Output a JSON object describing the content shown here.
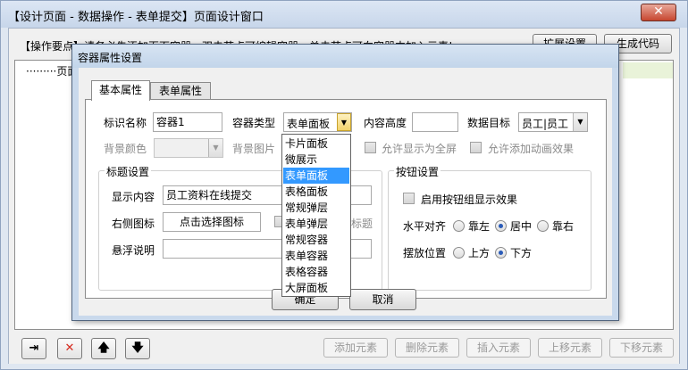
{
  "main_window": {
    "title": "【设计页面 - 数据操作 - 表单提交】页面设计窗口",
    "close_glyph": "✕",
    "hint": "【操作要点】请务必先添加页面容器，双击节点可编辑容器，单击节点可向容器中加入元素!",
    "buttons": {
      "extend": "扩展设置",
      "generate": "生成代码"
    },
    "tree": {
      "root_label": "·········页面容器"
    },
    "bottom_icons": {
      "insert_glyph": "⇥",
      "delete_glyph": "✕",
      "up_glyph": "🡅",
      "down_glyph": "🡇"
    },
    "bottom_buttons": {
      "add": "添加元素",
      "delete": "删除元素",
      "insert": "插入元素",
      "move_up": "上移元素",
      "move_down": "下移元素"
    },
    "colors": {
      "delete_icon": "#d62b1f"
    }
  },
  "dialog": {
    "title": "容器属性设置",
    "tabs": [
      "基本属性",
      "表单属性"
    ],
    "fields": {
      "id_label": "标识名称",
      "id_value": "容器1",
      "type_label": "容器类型",
      "type_value": "表单面板",
      "height_label": "内容高度",
      "height_value": "",
      "target_label": "数据目标",
      "target_value": "员工|员工",
      "bg_color_label": "背景颜色",
      "bg_image_label": "背景图片",
      "allow_fullscreen": "允许显示为全屏",
      "allow_animation": "允许添加动画效果"
    },
    "title_group": {
      "title": "标题设置",
      "display_label": "显示内容",
      "display_value": "员工资料在线提交",
      "right_icon_label": "右侧图标",
      "right_icon_button": "点击选择图标",
      "show_title_suffix": "标题",
      "tooltip_label": "悬浮说明",
      "tooltip_value": ""
    },
    "button_group": {
      "title": "按钮设置",
      "enable_effect": "启用按钮组显示效果",
      "h_align_label": "水平对齐",
      "h_align_options": [
        "靠左",
        "居中",
        "靠右"
      ],
      "h_align_selected": "居中",
      "position_label": "摆放位置",
      "position_options": [
        "上方",
        "下方"
      ],
      "position_selected": "下方"
    },
    "ok_button": "确定",
    "cancel_button": "取消",
    "type_dropdown": {
      "options": [
        "卡片面板",
        "微展示",
        "表单面板",
        "表格面板",
        "常规弹层",
        "表单弹层",
        "常规容器",
        "表单容器",
        "表格容器",
        "大屏面板"
      ],
      "highlighted": "表单面板"
    }
  }
}
